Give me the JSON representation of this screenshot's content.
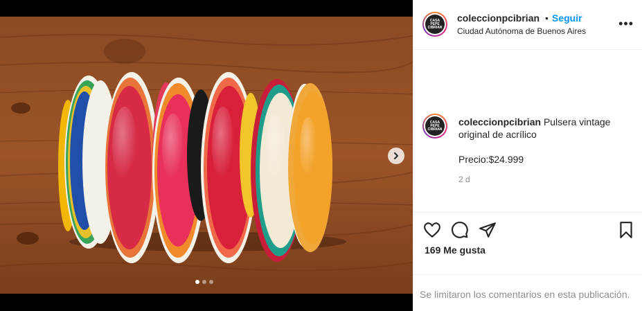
{
  "post": {
    "username": "coleccionpcibrian",
    "follow_label": "Seguir",
    "separator": "•",
    "location": "Ciudad Autónoma de Buenos Aires",
    "more_label": "•••",
    "avatar_logo_text": "CASA PEPE CIBRIAN",
    "caption_username": "coleccionpcibrian",
    "caption_text": "Pulsera vintage original de acrílico",
    "price_text": "Precio:$24.999",
    "age": "2 d",
    "likes": "169 Me gusta",
    "comments_disabled": "Se limitaron los comentarios en esta publicación."
  },
  "media": {
    "carousel_count": 3,
    "carousel_active": 1
  },
  "icons": {
    "like": "heart-icon",
    "comment": "comment-icon",
    "share": "paper-plane-icon",
    "save": "bookmark-icon",
    "next": "chevron-right-icon",
    "more": "ellipsis-icon"
  },
  "colors": {
    "link_blue": "#0095f6",
    "text": "#262626",
    "muted": "#8e8e8e",
    "border": "#efefef"
  }
}
